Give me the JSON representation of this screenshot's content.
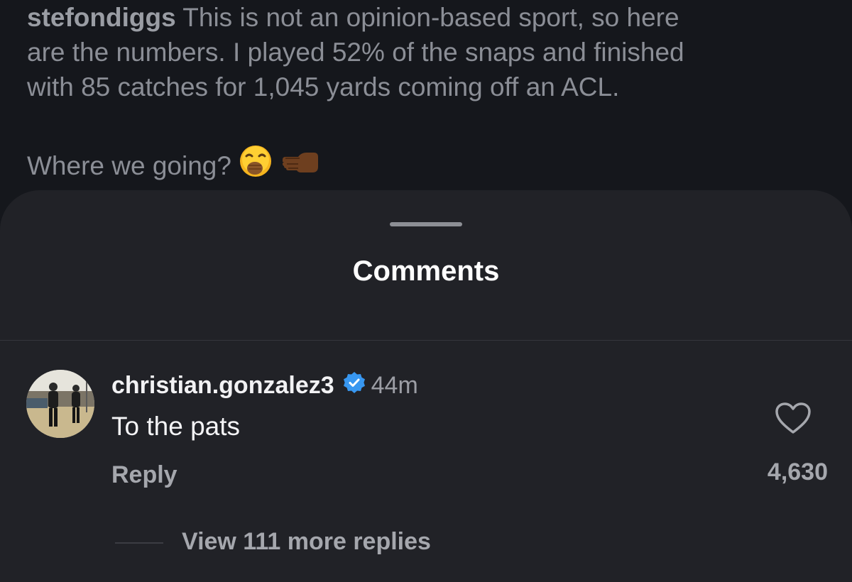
{
  "post": {
    "username": "stefondiggs",
    "caption_line1": " This is not an opinion-based sport, so here",
    "caption_line2": "are the numbers. I played 52% of the snaps and finished",
    "caption_line3": "with 85 catches for 1,045 yards coming off an ACL.",
    "question": "Where we going?",
    "emojis": [
      "face-with-hand-over-mouth-icon",
      "backhand-index-pointing-left-icon"
    ]
  },
  "sheet": {
    "title": "Comments"
  },
  "comment": {
    "username": "christian.gonzalez3",
    "verified": true,
    "time": "44m",
    "text": "To the pats",
    "reply_label": "Reply",
    "like_count": "4,630",
    "view_replies_label": "View 111 more replies"
  },
  "colors": {
    "background": "#15171c",
    "sheet": "#212227",
    "verified": "#3897f0",
    "secondary_text": "#a5a7ad"
  }
}
